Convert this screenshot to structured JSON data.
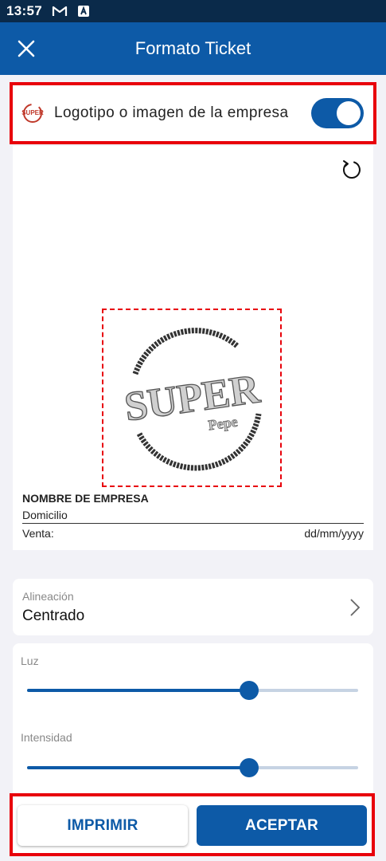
{
  "status_bar": {
    "time": "13:57",
    "icons": [
      "gmail-icon",
      "notification-icon"
    ]
  },
  "header": {
    "title": "Formato Ticket",
    "close_icon": "close-icon"
  },
  "logo_setting": {
    "label": "Logotipo o imagen de la empresa",
    "enabled": true,
    "logo_text": "SUPER"
  },
  "preview": {
    "logo_word_1": "SUPER",
    "logo_word_2": "Pepe",
    "business_name": "NOMBRE DE EMPRESA",
    "address": "Domicilio",
    "sale_label": "Venta:",
    "date_format": "dd/mm/yyyy"
  },
  "alignment": {
    "label": "Alineación",
    "value": "Centrado"
  },
  "sliders": [
    {
      "label": "Luz",
      "value": 0.67
    },
    {
      "label": "Intensidad",
      "value": 0.67
    }
  ],
  "actions": {
    "print_label": "IMPRIMIR",
    "accept_label": "ACEPTAR"
  },
  "colors": {
    "primary": "#0d5aa7",
    "status_bar": "#0a2a4a",
    "highlight": "#e8000b",
    "background": "#f2f2f7"
  }
}
